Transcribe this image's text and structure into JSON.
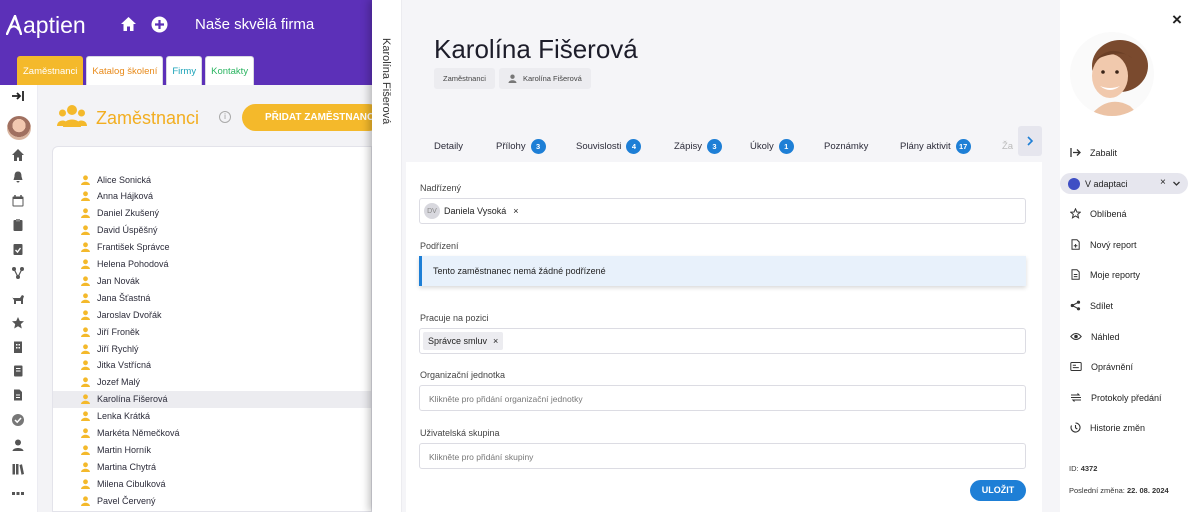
{
  "app": {
    "brand": "aptien",
    "company": "Naše skvělá firma",
    "colors": {
      "brand_purple": "#5c30b8",
      "accent_yellow": "#f4b92b",
      "primary_blue": "#1e7fd6"
    }
  },
  "category_tabs": [
    {
      "label": "Zaměstnanci"
    },
    {
      "label": "Katalog školení"
    },
    {
      "label": "Firmy"
    },
    {
      "label": "Kontakty"
    }
  ],
  "background": {
    "title": "Zaměstnanci",
    "add_button": "PŘIDAT ZAMĚSTNANCE",
    "employees": [
      "Alice Sonická",
      "Anna Hájková",
      "Daniel Zkušený",
      "David Úspěšný",
      "František Správce",
      "Helena Pohodová",
      "Jan Novák",
      "Jana Šťastná",
      "Jaroslav Dvořák",
      "Jiří Froněk",
      "Jiří Rychlý",
      "Jitka Vstřícná",
      "Jozef Malý",
      "Karolína Fišerová",
      "Lenka Krátká",
      "Markéta Němečková",
      "Martin Horník",
      "Martina Chytrá",
      "Milena Cibulková",
      "Pavel Červený"
    ],
    "selected_employee": "Karolína Fišerová"
  },
  "detail": {
    "vertical_name": "Karolína Fišerová",
    "name": "Karolína Fišerová",
    "breadcrumb": [
      "Zaměstnanci",
      "Karolína Fišerová"
    ],
    "tabs": [
      {
        "label": "Detaily",
        "badge": ""
      },
      {
        "label": "Přílohy",
        "badge": "3"
      },
      {
        "label": "Souvislosti",
        "badge": "4"
      },
      {
        "label": "Zápisy",
        "badge": "3"
      },
      {
        "label": "Úkoly",
        "badge": "1"
      },
      {
        "label": "Poznámky",
        "badge": ""
      },
      {
        "label": "Plány aktivit",
        "badge": "17"
      },
      {
        "label": "Ža",
        "badge": ""
      }
    ],
    "fields": {
      "nadrizeny": {
        "label": "Nadřízený",
        "value": "Daniela Vysoká",
        "initials": "DV"
      },
      "podrizeni": {
        "label": "Podřízení",
        "info": "Tento zaměstnanec nemá žádné podřízené"
      },
      "pozice": {
        "label": "Pracuje na pozici",
        "value": "Správce smluv"
      },
      "org": {
        "label": "Organizační jednotka",
        "placeholder": "Klikněte pro přidání organizační jednotky"
      },
      "skupina": {
        "label": "Uživatelská skupina",
        "placeholder": "Klikněte pro přidání skupiny"
      }
    },
    "save_label": "ULOŽIT"
  },
  "sidebar": {
    "close": "×",
    "actions": [
      {
        "label": "Zabalit",
        "icon": "collapse-icon"
      },
      {
        "label": "Oblíbená",
        "icon": "star-icon"
      },
      {
        "label": "Nový report",
        "icon": "new-report-icon"
      },
      {
        "label": "Moje reporty",
        "icon": "report-icon"
      },
      {
        "label": "Sdílet",
        "icon": "share-icon"
      },
      {
        "label": "Náhled",
        "icon": "eye-icon"
      },
      {
        "label": "Oprávnění",
        "icon": "permissions-icon"
      },
      {
        "label": "Protokoly předání",
        "icon": "handover-icon"
      },
      {
        "label": "Historie změn",
        "icon": "history-icon"
      }
    ],
    "status": "V adaptaci",
    "id_label": "ID:",
    "id_value": "4372",
    "last_change_label": "Poslední změna:",
    "last_change_value": "22. 08. 2024"
  }
}
